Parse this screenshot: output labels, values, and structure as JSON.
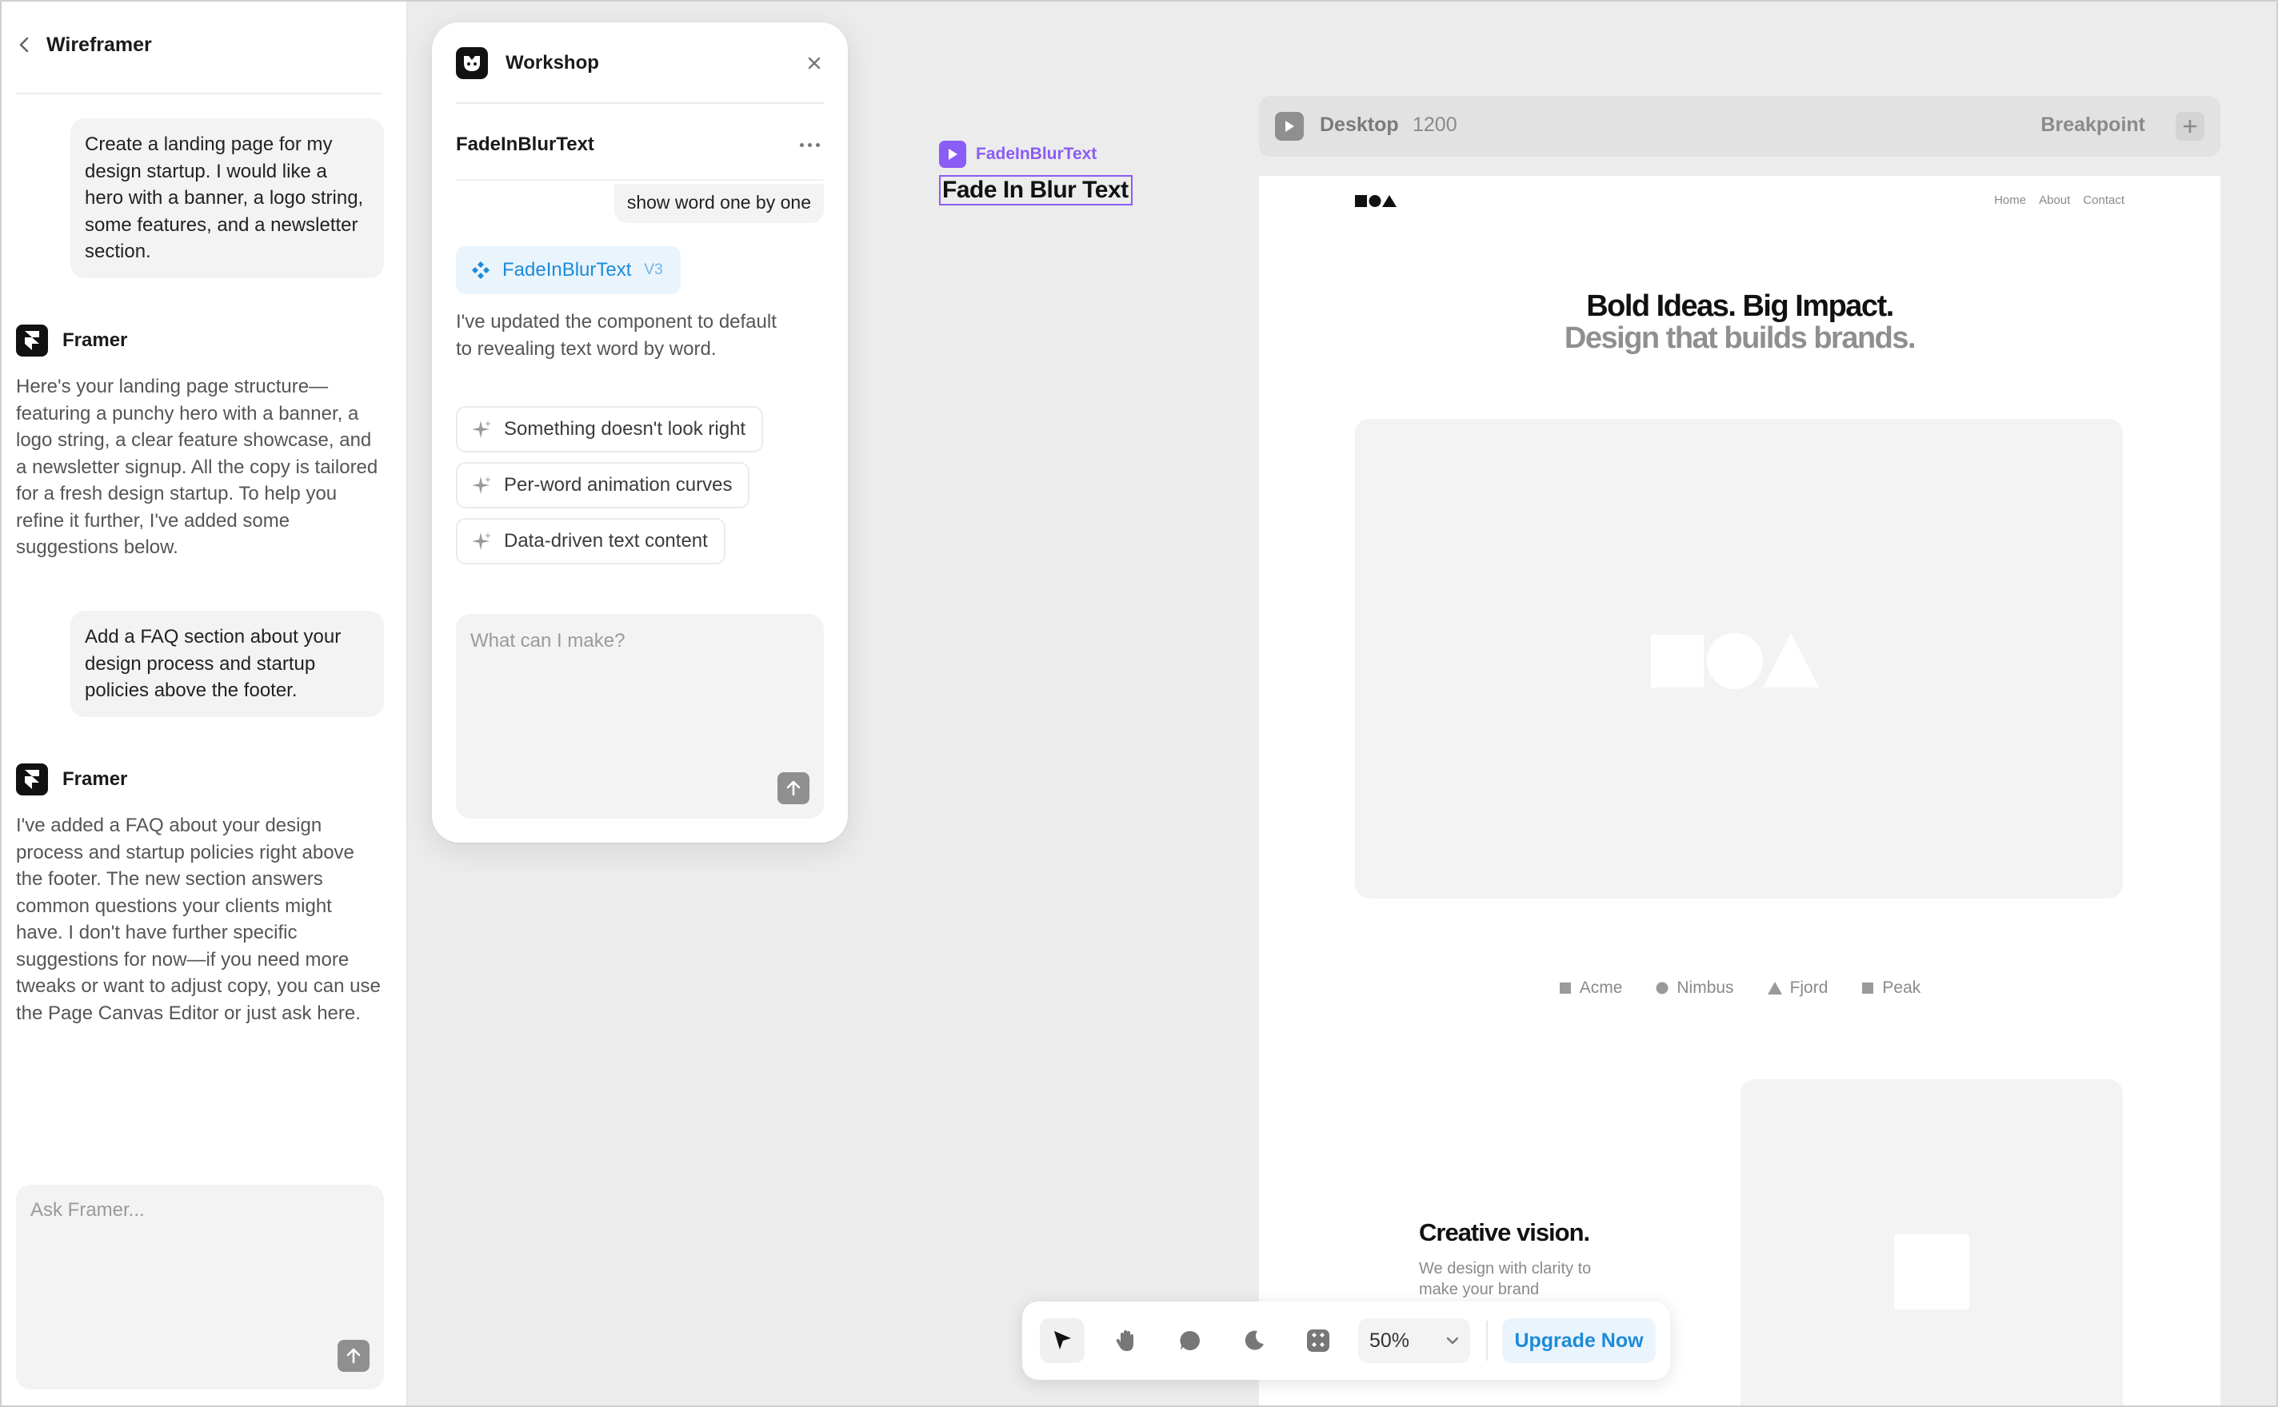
{
  "sidebar": {
    "title": "Wireframer",
    "messages": [
      {
        "role": "user",
        "text": "Create a landing page for my design startup. I would like a hero with a banner, a logo string, some features, and a newsletter section."
      },
      {
        "role": "assistant",
        "name": "Framer",
        "text": "Here's your landing page structure—featuring a punchy hero with a banner, a logo string, a clear feature showcase, and a newsletter signup. All the copy is tailored for a fresh design startup. To help you refine it further, I've added some suggestions below."
      },
      {
        "role": "user",
        "text": "Add a FAQ section about your design process and startup policies above the footer."
      },
      {
        "role": "assistant",
        "name": "Framer",
        "text": "I've added a FAQ about your design process and startup policies right above the footer. The new section answers common questions your clients might have. I don't have further specific suggestions for now—if you need more tweaks or want to adjust copy, you can use the Page Canvas Editor or just ask here."
      }
    ],
    "input_placeholder": "Ask Framer..."
  },
  "workshop": {
    "title": "Workshop",
    "component_name": "FadeInBlurText",
    "user_message": "show word one by one",
    "chip": {
      "name": "FadeInBlurText",
      "version": "V3"
    },
    "reply": "I've updated the component to default to revealing text word by word.",
    "suggestions": [
      "Something doesn't look right",
      "Per-word animation curves",
      "Data-driven text content"
    ],
    "input_placeholder": "What can I make?"
  },
  "canvas_component": {
    "tag": "FadeInBlurText",
    "text": "Fade In Blur Text",
    "accent": "#8b5cf6"
  },
  "breakpoint_bar": {
    "device": "Desktop",
    "width": "1200",
    "label": "Breakpoint"
  },
  "site": {
    "nav": [
      "Home",
      "About",
      "Contact"
    ],
    "hero_title": "Bold Ideas. Big Impact.",
    "hero_subtitle": "Design that builds brands.",
    "logos": [
      {
        "name": "Acme",
        "shape": "square"
      },
      {
        "name": "Nimbus",
        "shape": "circle"
      },
      {
        "name": "Fjord",
        "shape": "triangle"
      },
      {
        "name": "Peak",
        "shape": "square"
      }
    ],
    "feature_title": "Creative vision.",
    "feature_desc": "We design with clarity to make your brand"
  },
  "toolbar": {
    "tools": [
      "select-tool-icon",
      "hand-tool-icon",
      "comment-tool-icon",
      "dark-mode-icon",
      "components-icon"
    ],
    "zoom": "50%",
    "upgrade_label": "Upgrade Now",
    "accent": "#1c8bd8"
  }
}
